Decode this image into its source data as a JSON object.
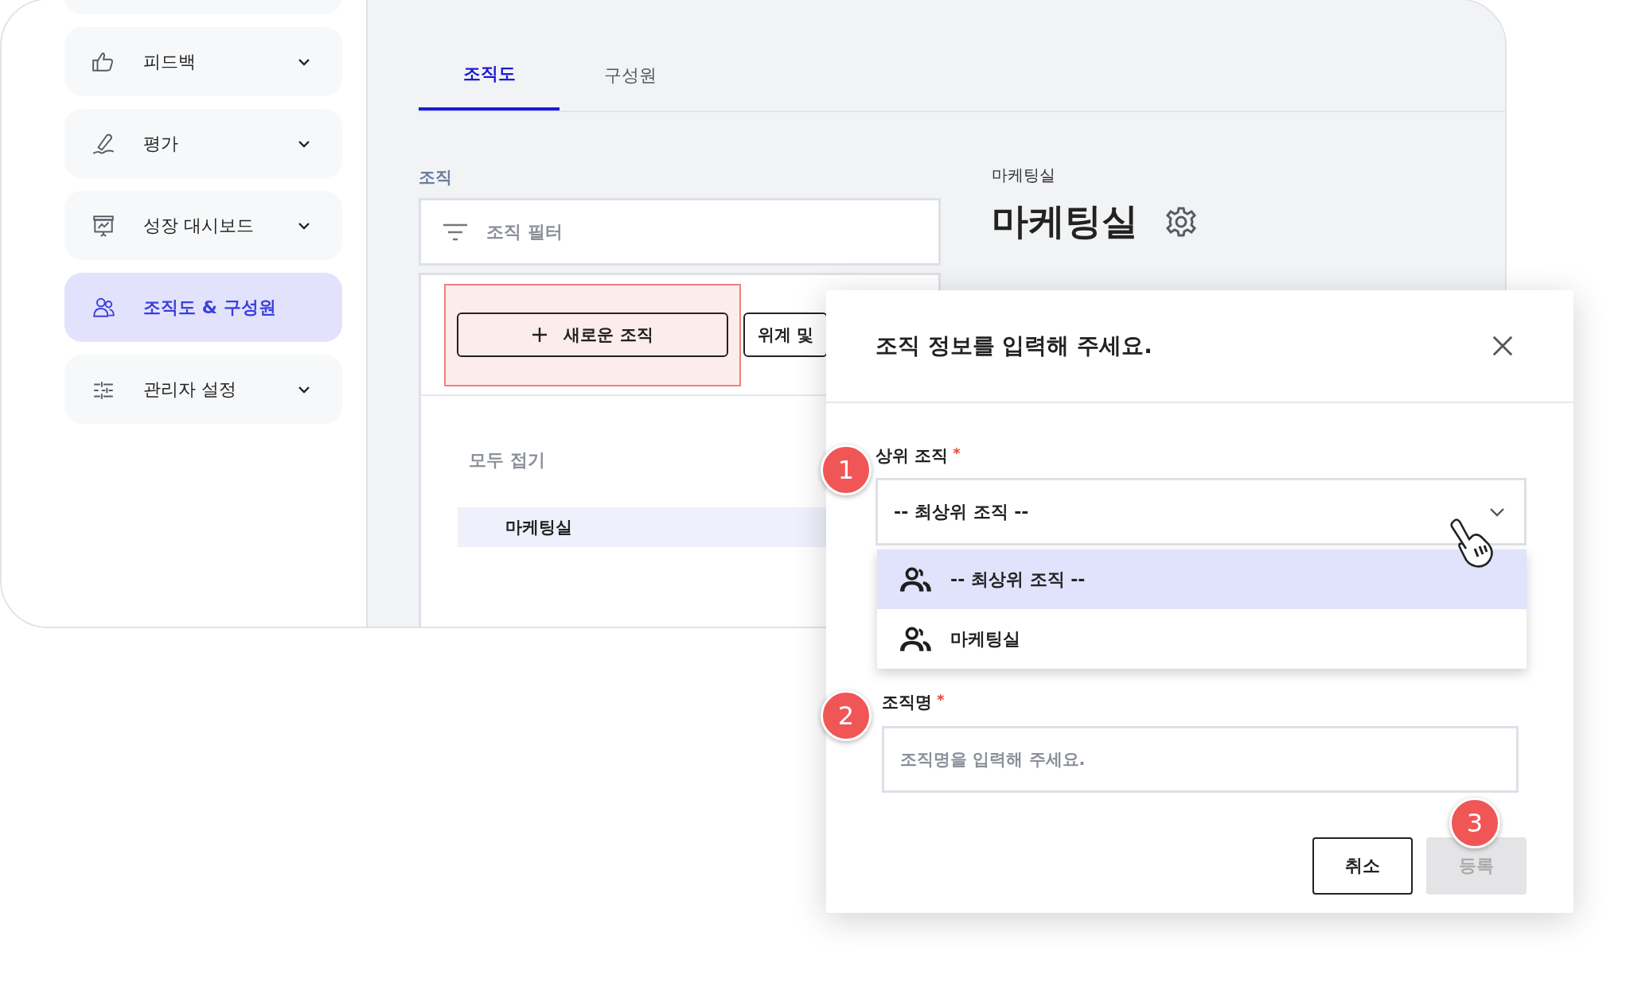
{
  "sidebar": {
    "items": [
      {
        "label": "피드백",
        "selected": false,
        "expandable": true
      },
      {
        "label": "평가",
        "selected": false,
        "expandable": true
      },
      {
        "label": "성장 대시보드",
        "selected": false,
        "expandable": true
      },
      {
        "label": "조직도 & 구성원",
        "selected": true,
        "expandable": false
      },
      {
        "label": "관리자 설정",
        "selected": false,
        "expandable": true
      }
    ]
  },
  "tabs": [
    {
      "label": "조직도",
      "selected": true
    },
    {
      "label": "구성원",
      "selected": false
    }
  ],
  "org_panel": {
    "label": "조직",
    "filter_placeholder": "조직 필터",
    "buttons": [
      {
        "label": "새로운 조직",
        "highlighted": true
      },
      {
        "label": "위계 및",
        "highlighted": false
      }
    ],
    "collapse_all": "모두 접기",
    "tree": [
      {
        "label": "마케팅실",
        "selected": true
      }
    ]
  },
  "detail": {
    "breadcrumb": "마케팅실",
    "title": "마케팅실"
  },
  "dialog": {
    "title": "조직 정보를 입력해 주세요.",
    "fields": [
      {
        "kind": "select",
        "label": "상위 조직",
        "required_mark": "*",
        "value": "-- 최상위 조직 --",
        "options": [
          {
            "label": "-- 최상위 조직 --",
            "selected": true
          },
          {
            "label": "마케팅실",
            "selected": false
          }
        ]
      },
      {
        "kind": "text",
        "label": "조직명",
        "required_mark": "*",
        "placeholder": "조직명을 입력해 주세요."
      }
    ],
    "buttons": [
      {
        "label": "취소",
        "disabled": false
      },
      {
        "label": "등록",
        "disabled": true
      }
    ]
  },
  "steps": [
    {
      "label": "1"
    },
    {
      "label": "2"
    },
    {
      "label": "3"
    }
  ]
}
